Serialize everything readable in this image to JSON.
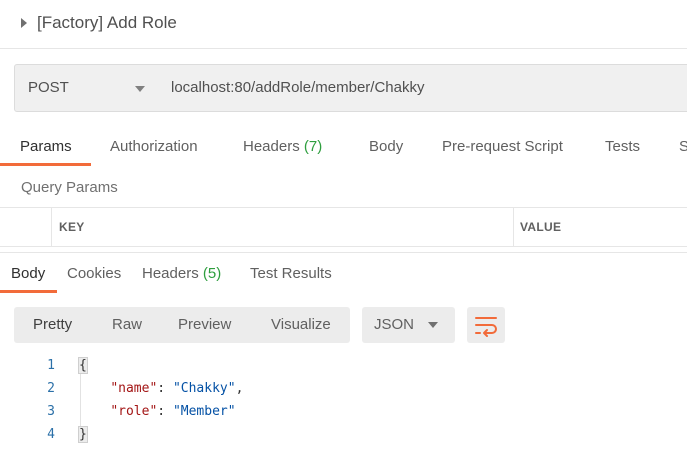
{
  "title": {
    "text": "[Factory] Add Role"
  },
  "request": {
    "method": "POST",
    "url": "localhost:80/addRole/member/Chakky"
  },
  "request_tabs": {
    "params": "Params",
    "authorization": "Authorization",
    "headers": "Headers",
    "headers_count": "(7)",
    "body": "Body",
    "prerequest": "Pre-request Script",
    "tests": "Tests",
    "settings_partial": "S"
  },
  "query_params": {
    "label": "Query Params",
    "key_header": "KEY",
    "value_header": "VALUE"
  },
  "response_tabs": {
    "body": "Body",
    "cookies": "Cookies",
    "headers": "Headers",
    "headers_count": "(5)",
    "test_results": "Test Results"
  },
  "view_toolbar": {
    "pretty": "Pretty",
    "raw": "Raw",
    "preview": "Preview",
    "visualize": "Visualize",
    "format": "JSON",
    "wrap_icon": "wrap-lines-icon"
  },
  "response_body": {
    "line_numbers": [
      "1",
      "2",
      "3",
      "4"
    ],
    "open_brace": "{",
    "close_brace": "}",
    "fields": [
      {
        "key": "\"name\"",
        "value": "\"Chakky\"",
        "trail": ","
      },
      {
        "key": "\"role\"",
        "value": "\"Member\"",
        "trail": ""
      }
    ]
  },
  "colors": {
    "accent": "#f26b3a",
    "count_green": "#2e9e3e",
    "json_key": "#a31515",
    "json_string": "#0451a5"
  }
}
